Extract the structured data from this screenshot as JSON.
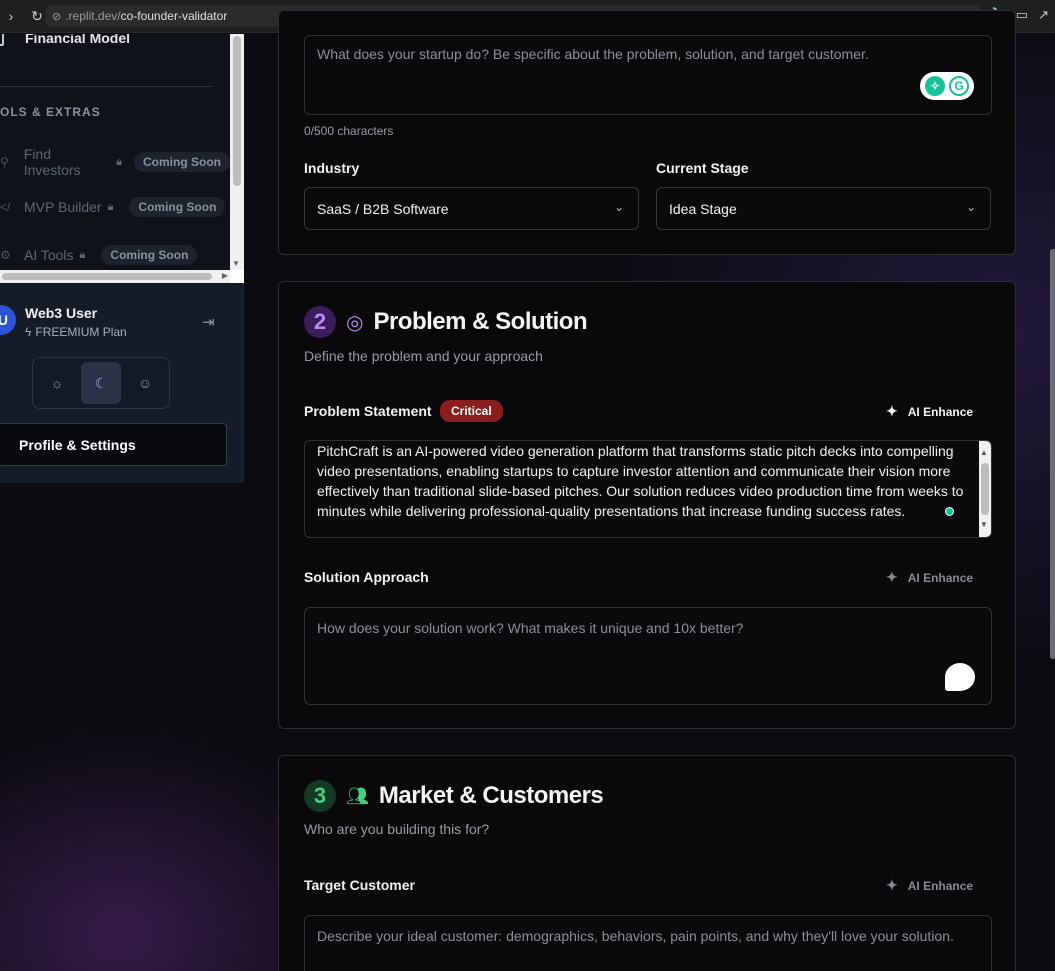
{
  "browser": {
    "url_host": ".replit.dev/",
    "url_path": "co-founder-validator"
  },
  "sidebar": {
    "financial_model": "Financial Model",
    "section_label": "OLS & EXTRAS",
    "items": [
      {
        "label": "Find Investors",
        "badge": "Coming Soon"
      },
      {
        "label": "MVP Builder",
        "badge": "Coming Soon"
      },
      {
        "label": "AI Tools",
        "badge": "Coming Soon"
      }
    ],
    "user": {
      "avatar_initial": "U",
      "name": "Web3 User",
      "plan": "FREEMIUM Plan"
    },
    "profile_button": "Profile & Settings"
  },
  "overview": {
    "description_placeholder": "What does your startup do? Be specific about the problem, solution, and target customer.",
    "char_count": "0/500 characters",
    "industry_label": "Industry",
    "industry_value": "SaaS / B2B Software",
    "stage_label": "Current Stage",
    "stage_value": "Idea Stage"
  },
  "problem_solution": {
    "number": "2",
    "title": "Problem & Solution",
    "subtitle": "Define the problem and your approach",
    "problem_label": "Problem Statement",
    "critical_badge": "Critical",
    "ai_enhance": "AI Enhance",
    "problem_text": "PitchCraft is an AI-powered video generation platform that transforms static pitch decks into compelling video presentations, enabling startups to capture investor attention and communicate their vision more effectively than traditional slide-based pitches. Our solution reduces video production time from weeks to minutes while delivering professional-quality presentations that increase funding success rates.",
    "solution_label": "Solution Approach",
    "solution_placeholder": "How does your solution work? What makes it unique and 10x better?"
  },
  "market": {
    "number": "3",
    "title": "Market & Customers",
    "subtitle": "Who are you building this for?",
    "target_label": "Target Customer",
    "ai_enhance": "AI Enhance",
    "target_placeholder": "Describe your ideal customer: demographics, behaviors, pain points, and why they'll love your solution."
  },
  "colors": {
    "accent_purple": "#a855f7",
    "accent_green": "#22c55e",
    "critical_red": "#8c1d1d"
  }
}
